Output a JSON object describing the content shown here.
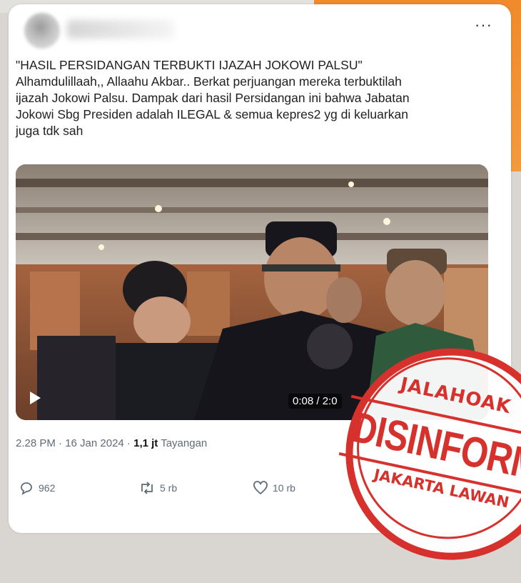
{
  "tweet": {
    "headline": "\"HASIL PERSIDANGAN TERBUKTI IJAZAH JOKOWI PALSU\"",
    "lines": [
      "Alhamdulillaah,, Allaahu Akbar.. Berkat perjuangan mereka terbuktilah",
      "ijazah Jokowi Palsu. Dampak dari hasil Persidangan ini bahwa Jabatan",
      "Jokowi Sbg Presiden adalah ILEGAL & semua kepres2 yg di keluarkan",
      "juga tdk sah"
    ],
    "more_icon": "···"
  },
  "video": {
    "time": "0:08 / 2:0"
  },
  "meta": {
    "timestamp": "2.28 PM · 16 Jan 2024 ·",
    "views": "1,1 jt",
    "views_label": "Tayangan"
  },
  "actions": {
    "replies": "962",
    "reposts": "5 rb",
    "likes": "10 rb"
  },
  "stamp": {
    "top": "JALAHOAK",
    "main": "DISINFORM",
    "bottom": "JAKARTA LAWAN"
  },
  "colors": {
    "stamp_red": "#d6312c",
    "accent_orange": "#f08a2c"
  }
}
